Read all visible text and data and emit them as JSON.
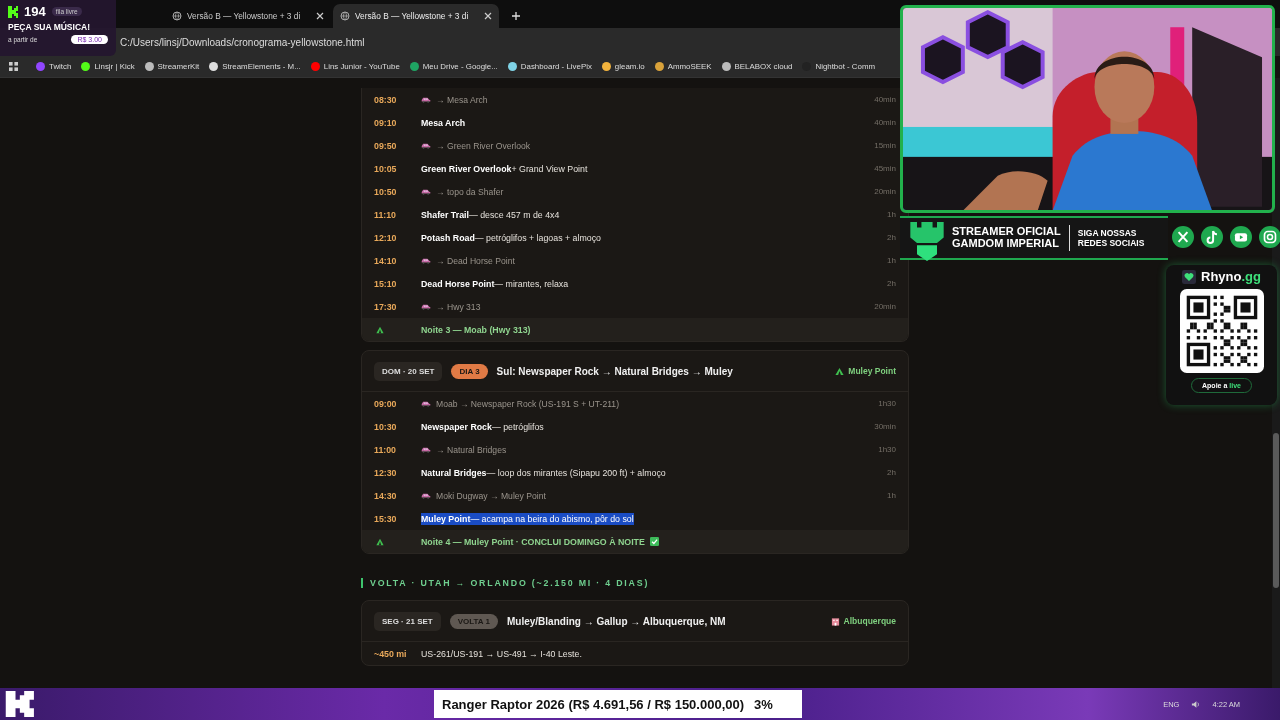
{
  "overlay_badge": {
    "count": "194",
    "queue": "fila livre",
    "title": "PEÇA SUA MÚSICA!",
    "price_label": "a partir de",
    "price": "R$ 3.00"
  },
  "tabs": [
    {
      "title": "Versão B — Yellowstone + 3 di",
      "selected": false
    },
    {
      "title": "Versão B — Yellowstone + 3 di",
      "selected": true
    }
  ],
  "address": "C:/Users/linsj/Downloads/cronograma-yellowstone.html",
  "bookmarks": [
    {
      "label": "Twitch",
      "color": "#9146ff"
    },
    {
      "label": "Linsjr | Kick",
      "color": "#53fc18"
    },
    {
      "label": "StreamerKit",
      "color": "#bbbbbb"
    },
    {
      "label": "StreamElements - M...",
      "color": "#dddddd"
    },
    {
      "label": "Lins Junior - YouTube",
      "color": "#ff0000"
    },
    {
      "label": "Meu Drive - Google...",
      "color": "#1fa463"
    },
    {
      "label": "Dashboard - LivePix",
      "color": "#7fd3e6"
    },
    {
      "label": "gleam.io",
      "color": "#f2b33d"
    },
    {
      "label": "AmmoSEEK",
      "color": "#d9a23a"
    },
    {
      "label": "BELABOX cloud",
      "color": "#bbbbbb"
    },
    {
      "label": "Nightbot - Comm",
      "color": "#222222"
    }
  ],
  "sections": [
    {
      "days": [
        {
          "rows": [
            {
              "time": "08:30",
              "kind": "drive",
              "text": "→ Mesa Arch",
              "duration": "40min",
              "highlighted": false
            },
            {
              "time": "09:10",
              "kind": "stop",
              "place": "Mesa Arch",
              "duration": "40min",
              "highlighted": false
            },
            {
              "time": "09:50",
              "kind": "drive",
              "text": "→ Green River Overlook",
              "duration": "15min",
              "highlighted": false
            },
            {
              "time": "10:05",
              "kind": "stop",
              "place": "Green River Overlook",
              "note": "+ Grand View Point",
              "duration": "45min",
              "highlighted": false
            },
            {
              "time": "10:50",
              "kind": "drive",
              "text": "→ topo da Shafer",
              "duration": "20min",
              "highlighted": false
            },
            {
              "time": "11:10",
              "kind": "stop",
              "place": "Shafer Trail",
              "note": "— desce 457 m de 4x4",
              "duration": "1h",
              "highlighted": false
            },
            {
              "time": "12:10",
              "kind": "stop",
              "place": "Potash Road",
              "note": "— petróglifos + lagoas + almoço",
              "duration": "2h",
              "highlighted": false
            },
            {
              "time": "14:10",
              "kind": "drive",
              "text": "→ Dead Horse Point",
              "duration": "1h",
              "highlighted": false
            },
            {
              "time": "15:10",
              "kind": "stop",
              "place": "Dead Horse Point",
              "note": "— mirantes, relaxa",
              "duration": "2h",
              "highlighted": false
            },
            {
              "time": "17:30",
              "kind": "drive",
              "text": "→ Hwy 313",
              "duration": "20min",
              "highlighted": false
            }
          ],
          "night": {
            "text": "Noite 3 — Moab (Hwy 313)",
            "done": false
          }
        },
        {
          "date": "DOM · 20 SET",
          "badge": "DIA 3",
          "color": "#e07a45",
          "title": "Sul: Newspaper Rock → Natural Bridges → Muley",
          "stay": "Muley Point",
          "kind": "camp",
          "rows": [
            {
              "time": "09:00",
              "kind": "drive",
              "text": "Moab → Newspaper Rock (US-191 S + UT-211)",
              "duration": "1h30",
              "highlighted": false
            },
            {
              "time": "10:30",
              "kind": "stop",
              "place": "Newspaper Rock",
              "note": "— petróglifos",
              "duration": "30min",
              "highlighted": false
            },
            {
              "time": "11:00",
              "kind": "drive",
              "text": "→ Natural Bridges",
              "duration": "1h30",
              "highlighted": false
            },
            {
              "time": "12:30",
              "kind": "stop",
              "place": "Natural Bridges",
              "note": "— loop dos mirantes (Sipapu 200 ft) + almoço",
              "duration": "2h",
              "highlighted": false
            },
            {
              "time": "14:30",
              "kind": "drive",
              "text": "Moki Dugway → Muley Point",
              "duration": "1h",
              "highlighted": false
            },
            {
              "time": "15:30",
              "kind": "stop",
              "place": "Muley Point",
              "note": "— acampa na beira do abismo, pôr do sol",
              "highlighted": true
            }
          ],
          "night": {
            "text": "Noite 4 — Muley Point · CONCLUI DOMINGO À NOITE",
            "done": true
          }
        }
      ]
    },
    {
      "heading": "VOLTA · UTAH → ORLANDO (~2.150 MI · 4 DIAS)",
      "days": [
        {
          "date": "SEG · 21 SET",
          "badge": "VOLTA 1",
          "color": "#5f5852",
          "title": "Muley/Blanding → Gallup → Albuquerque, NM",
          "stay": "Albuquerque",
          "kind": "hotel",
          "rows": [
            {
              "time": "~450 mi",
              "kind": "route",
              "text": "US-261/US-191 → US-491 → I-40 Leste.",
              "highlighted": false
            }
          ]
        }
      ]
    }
  ],
  "gamdom": {
    "line1": "STREAMER OFICIAL",
    "line2": "GAMDOM IMPERIAL",
    "follow1": "SIGA NOSSAS",
    "follow2": "REDES SOCIAIS"
  },
  "socials": [
    {
      "kind": "x"
    },
    {
      "kind": "tiktok"
    },
    {
      "kind": "youtube"
    },
    {
      "kind": "instagram"
    }
  ],
  "support_card": {
    "brand": "Rhyno",
    "brand_suffix": ".gg",
    "cta": "Apoie a",
    "cta_highlight": "live"
  },
  "donation_goal": {
    "text": "Ranger Raptor 2026 (R$ 4.691,56 / R$ 150.000,00)",
    "percent": "3%"
  },
  "tray": {
    "language": "ENG",
    "time": "4:22 AM"
  }
}
